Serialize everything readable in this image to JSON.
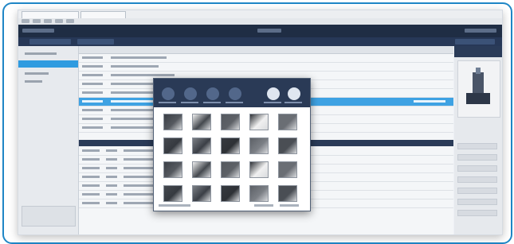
{
  "app": {
    "window_tabs": [
      "",
      ""
    ],
    "menus": [
      "",
      "",
      "",
      "",
      ""
    ]
  },
  "dialog": {
    "title": "",
    "thumbnails_count": 20
  },
  "colors": {
    "frame_border": "#1f86c6",
    "app_header": "#1f2d44",
    "selection": "#3ea2e3",
    "dialog_header": "#2a3a56"
  },
  "icons": {
    "dialog_buttons": [
      "scan-icon",
      "rotate-icon",
      "crop-icon",
      "delete-icon",
      "import-icon",
      "export-icon"
    ]
  }
}
